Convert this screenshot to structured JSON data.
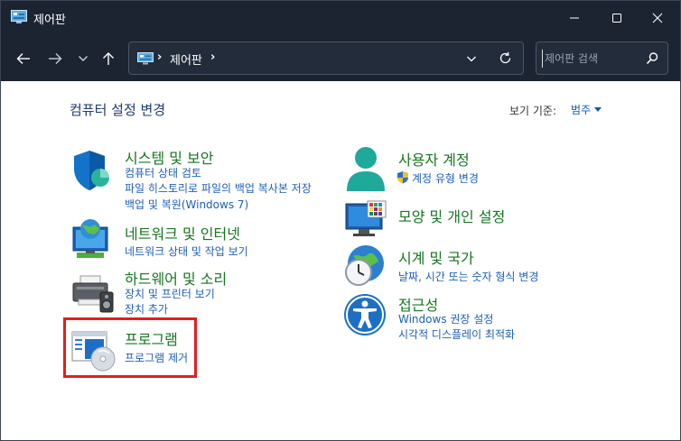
{
  "window": {
    "title": "제어판",
    "colors": {
      "titlebar_bg": "#1c2432",
      "content_bg": "#ffffff",
      "category_title": "#15761f",
      "link": "#1d5fb8",
      "highlight": "#e41e1e"
    }
  },
  "address": {
    "breadcrumb": "제어판",
    "separator": "›"
  },
  "search": {
    "placeholder": "제어판 검색"
  },
  "content": {
    "title": "컴퓨터 설정 변경",
    "view_by_label": "보기 기준:",
    "view_by_value": "범주"
  },
  "categories": [
    {
      "id": "system-security",
      "title": "시스템 및 보안",
      "icon": "shield-icon",
      "links": [
        "컴퓨터 상태 검토",
        "파일 히스토리로 파일의 백업 복사본 저장",
        "백업 및 복원(Windows 7)"
      ]
    },
    {
      "id": "network-internet",
      "title": "네트워크 및 인터넷",
      "icon": "network-globe-icon",
      "links": [
        "네트워크 상태 및 작업 보기"
      ]
    },
    {
      "id": "hardware-sound",
      "title": "하드웨어 및 소리",
      "icon": "printer-speaker-icon",
      "links": [
        "장치 및 프린터 보기",
        "장치 추가"
      ]
    },
    {
      "id": "programs",
      "title": "프로그램",
      "icon": "programs-disc-icon",
      "links": [
        "프로그램 제거"
      ]
    },
    {
      "id": "user-accounts",
      "title": "사용자 계정",
      "icon": "user-icon",
      "links": [
        "계정 유형 변경"
      ]
    },
    {
      "id": "appearance",
      "title": "모양 및 개인 설정",
      "icon": "monitor-personalize-icon",
      "links": []
    },
    {
      "id": "clock-region",
      "title": "시계 및 국가",
      "icon": "clock-globe-icon",
      "links": [
        "날짜, 시간 또는 숫자 형식 변경"
      ]
    },
    {
      "id": "ease-of-access",
      "title": "접근성",
      "icon": "accessibility-icon",
      "links": [
        "Windows 권장 설정",
        "시각적 디스플레이 최적화"
      ]
    }
  ]
}
